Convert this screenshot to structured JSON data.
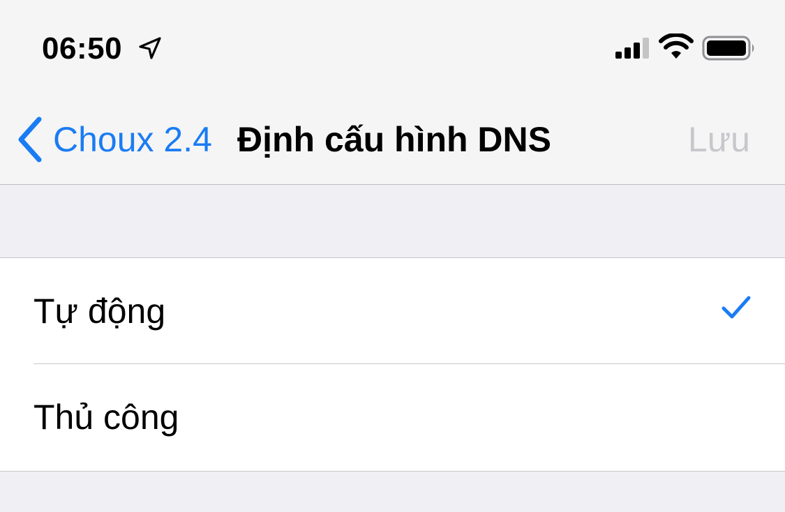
{
  "status_bar": {
    "time": "06:50",
    "icons": [
      "location-arrow-icon",
      "cellular-signal-icon",
      "wifi-icon",
      "battery-icon"
    ]
  },
  "nav": {
    "back_label": "Choux 2.4",
    "title": "Định cấu hình DNS",
    "save_label": "Lưu",
    "save_enabled": false
  },
  "options": [
    {
      "label": "Tự động",
      "selected": true
    },
    {
      "label": "Thủ công",
      "selected": false
    }
  ],
  "colors": {
    "accent": "#1a7cf3",
    "disabled": "#c7c7cc",
    "background": "#efeff4",
    "chrome": "#f5f5f5"
  }
}
